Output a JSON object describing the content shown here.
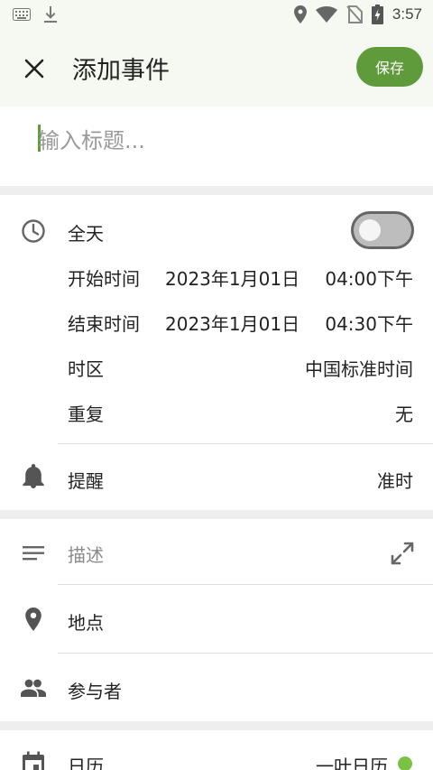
{
  "status_bar": {
    "time": "3:57"
  },
  "app_bar": {
    "title": "添加事件",
    "save_label": "保存"
  },
  "title_field": {
    "placeholder": "输入标题..."
  },
  "all_day": {
    "label": "全天",
    "enabled": false
  },
  "start": {
    "label": "开始时间",
    "date": "2023年1月01日",
    "time": "04:00下午"
  },
  "end": {
    "label": "结束时间",
    "date": "2023年1月01日",
    "time": "04:30下午"
  },
  "timezone": {
    "label": "时区",
    "value": "中国标准时间"
  },
  "repeat": {
    "label": "重复",
    "value": "无"
  },
  "reminder": {
    "label": "提醒",
    "value": "准时"
  },
  "description": {
    "placeholder": "描述"
  },
  "location": {
    "label": "地点"
  },
  "attendees": {
    "label": "参与者"
  },
  "calendar": {
    "label": "日历",
    "value": "一叶日历",
    "color": "#7cc242"
  },
  "colors": {
    "accent": "#5f9a3b",
    "app_bar_bg": "#f6f9f1"
  }
}
